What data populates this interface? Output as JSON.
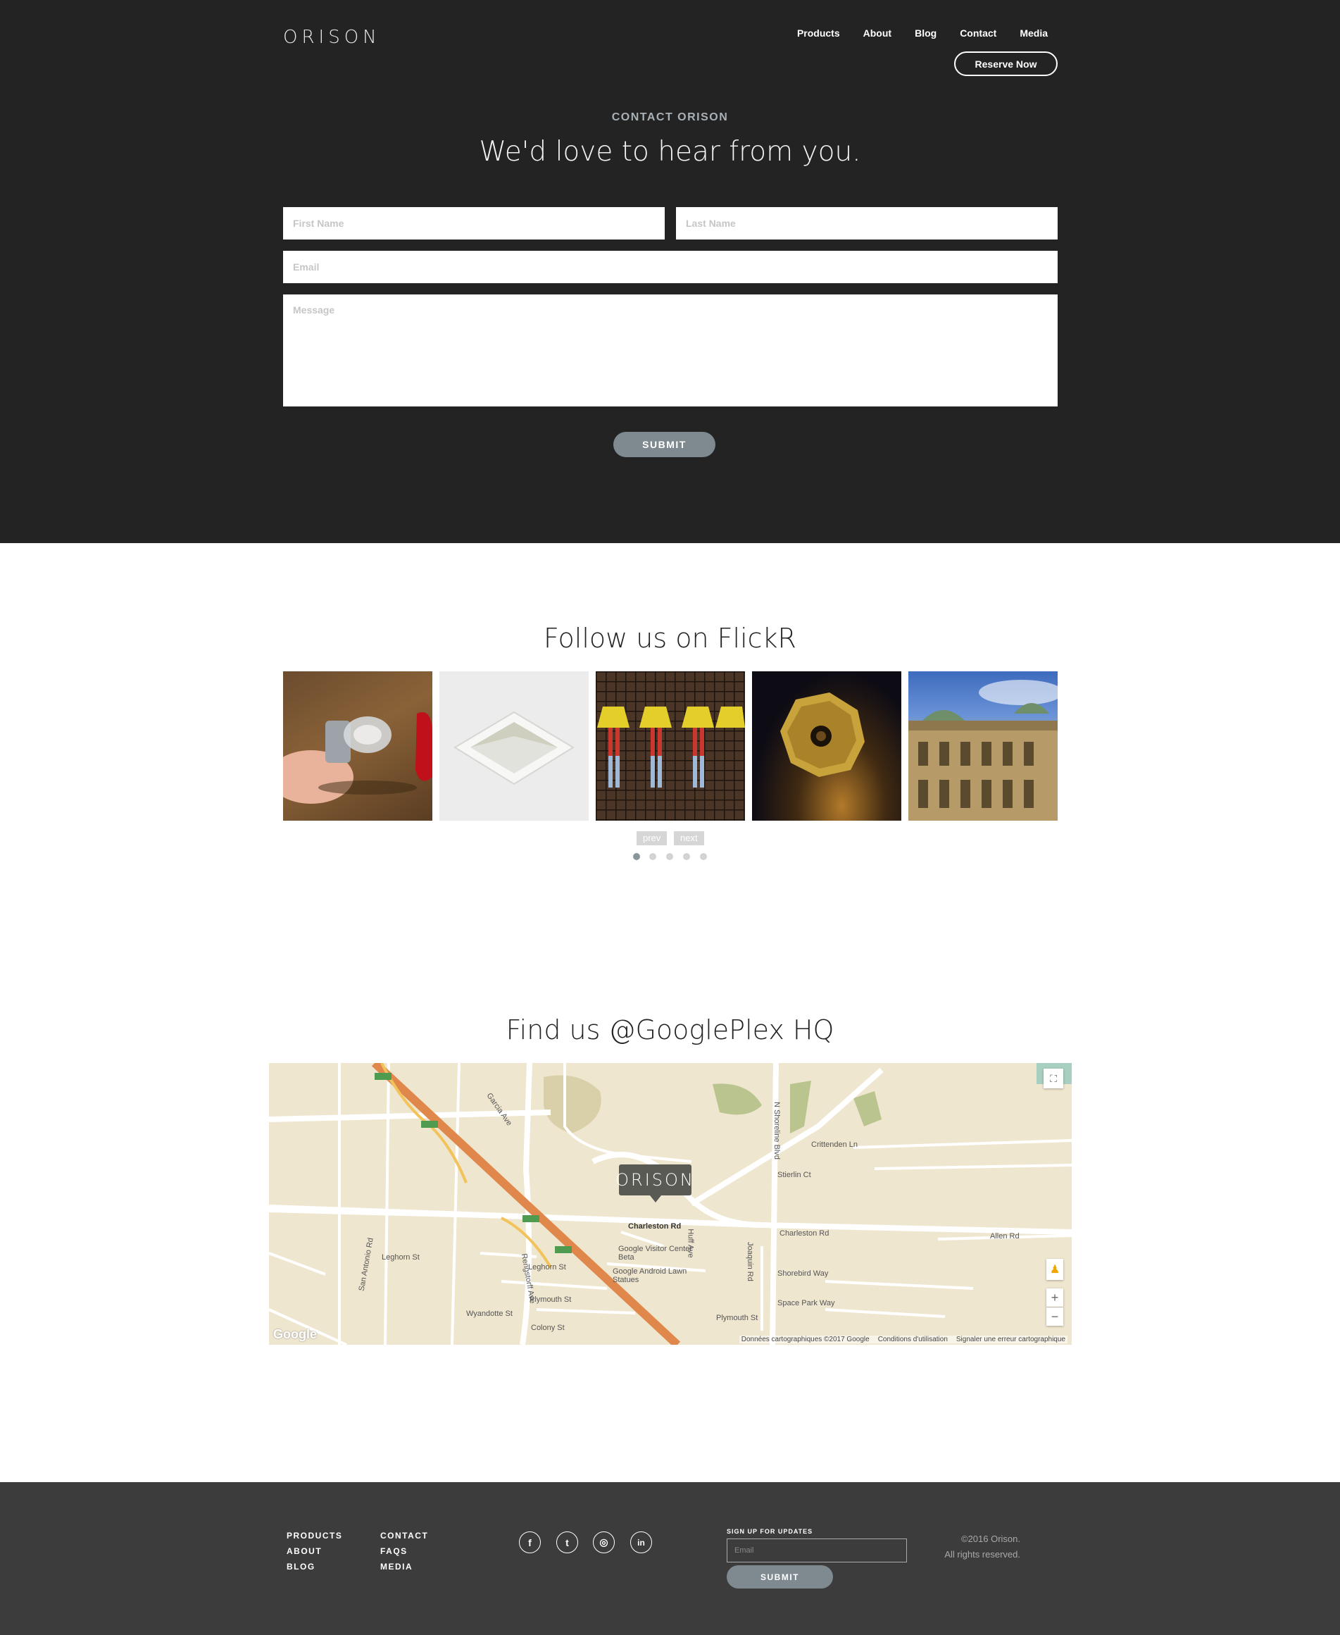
{
  "brand": {
    "logo_text": "ORISON"
  },
  "nav": {
    "items": [
      "Products",
      "About",
      "Blog",
      "Contact",
      "Media"
    ],
    "reserve_label": "Reserve Now"
  },
  "contact": {
    "eyebrow": "CONTACT ORISON",
    "title": "We'd love to hear from you.",
    "first_name_placeholder": "First Name",
    "last_name_placeholder": "Last Name",
    "email_placeholder": "Email",
    "message_placeholder": "Message",
    "submit_label": "SUBMIT"
  },
  "flickr": {
    "title": "Follow us on FlickR",
    "photos": [
      "bulb-photo",
      "recessed-light-photo",
      "lamp-legs-photo",
      "gold-knob-photo",
      "opera-building-photo"
    ],
    "prev_label": "prev",
    "next_label": "next",
    "dots": 5,
    "active_dot": 0
  },
  "map": {
    "title": "Find us @GooglePlex HQ",
    "marker_text": "ORISON",
    "labels": {
      "charleston_rd": "Charleston Rd",
      "charleston_rd_east": "Charleston Rd",
      "visitor_center": "Google Visitor Center Beta",
      "android_statues": "Google Android Lawn Statues",
      "leghorn_st": "Leghorn St",
      "leghorn_st_west": "Leghorn St",
      "plymouth_st": "Plymouth St",
      "plymouth_st_east": "Plymouth St",
      "colony_st": "Colony St",
      "wyandotte_st": "Wyandotte St",
      "crittenden_ln": "Crittenden Ln",
      "stierlin_ct": "Stierlin Ct",
      "shorebird_way": "Shorebird Way",
      "space_park_way": "Space Park Way",
      "allen_rd": "Allen Rd",
      "garcia_ave": "Garcia Ave",
      "san_antonio_rd": "San Antonio Rd",
      "rengstorff_ave": "Rengstorff Ave",
      "n_shoreline_blvd": "N Shoreline Blvd",
      "joaquin_rd": "Joaquin Rd",
      "huff_ave": "Huff Ave"
    },
    "google_logo": "Google",
    "credits": [
      "Données cartographiques ©2017 Google",
      "Conditions d'utilisation",
      "Signaler une erreur cartographique"
    ],
    "zoom_in": "+",
    "zoom_out": "−"
  },
  "footer": {
    "col1": [
      "PRODUCTS",
      "ABOUT",
      "BLOG"
    ],
    "col2": [
      "CONTACT",
      "FAQS",
      "MEDIA"
    ],
    "social": [
      {
        "name": "facebook-icon",
        "glyph": "f"
      },
      {
        "name": "twitter-icon",
        "glyph": "t"
      },
      {
        "name": "instagram-icon",
        "glyph": "◎"
      },
      {
        "name": "linkedin-icon",
        "glyph": "in"
      }
    ],
    "signup_label": "SIGN UP FOR UPDATES",
    "signup_placeholder": "Email",
    "signup_submit": "SUBMIT",
    "copyright_line1": "©2016 Orison.",
    "copyright_line2": "All rights reserved."
  },
  "colors": {
    "hero_bg": "#232323",
    "footer_bg": "#3c3c3c",
    "button_gray": "#7e8a90",
    "map_land": "#efe6cf",
    "highway": "#e0884b"
  }
}
